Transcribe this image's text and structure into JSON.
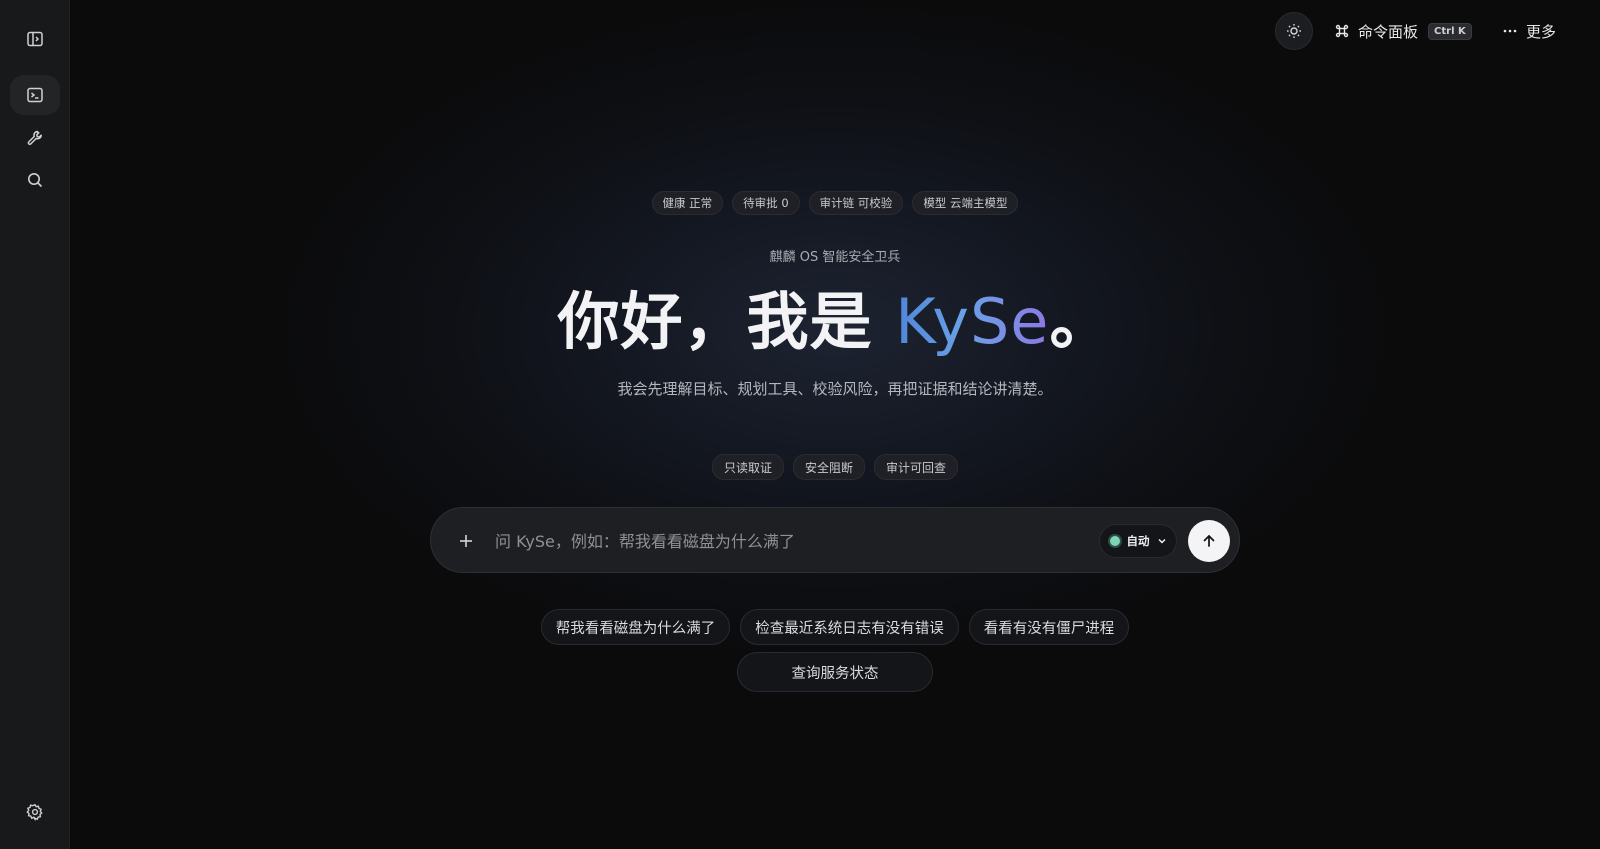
{
  "topbar": {
    "command_palette_label": "命令面板",
    "command_shortcut": "Ctrl K",
    "more_label": "更多"
  },
  "status_pills": [
    "健康 正常",
    "待审批 0",
    "审计链 可校验",
    "模型 云端主模型"
  ],
  "hero": {
    "subtitle": "麒麟 OS 智能安全卫兵",
    "headline_prefix": "你好，我是 ",
    "headline_brand": "KySe",
    "headline_suffix": "。",
    "tagline": "我会先理解目标、规划工具、校验风险，再把证据和结论讲清楚。"
  },
  "feature_pills": [
    "只读取证",
    "安全阻断",
    "审计可回查"
  ],
  "composer": {
    "placeholder": "问 KySe，例如：帮我看看磁盘为什么满了",
    "mode_label": "自动"
  },
  "suggestions": {
    "row1": [
      "帮我看看磁盘为什么满了",
      "检查最近系统日志有没有错误",
      "看看有没有僵尸进程"
    ],
    "row2": [
      "查询服务状态"
    ]
  },
  "colors": {
    "brand_gradient_start": "#4f86d9",
    "brand_gradient_end": "#8d79e4",
    "status_dot": "#7fd3b6"
  },
  "icons": {
    "sidebar": [
      "sidebar-toggle-icon",
      "terminal-icon",
      "wrench-icon",
      "search-icon",
      "gear-icon"
    ],
    "topbar": [
      "sun-icon",
      "command-icon",
      "more-dots-icon"
    ],
    "composer": [
      "plus-icon",
      "chevron-down-icon",
      "arrow-up-icon"
    ]
  }
}
